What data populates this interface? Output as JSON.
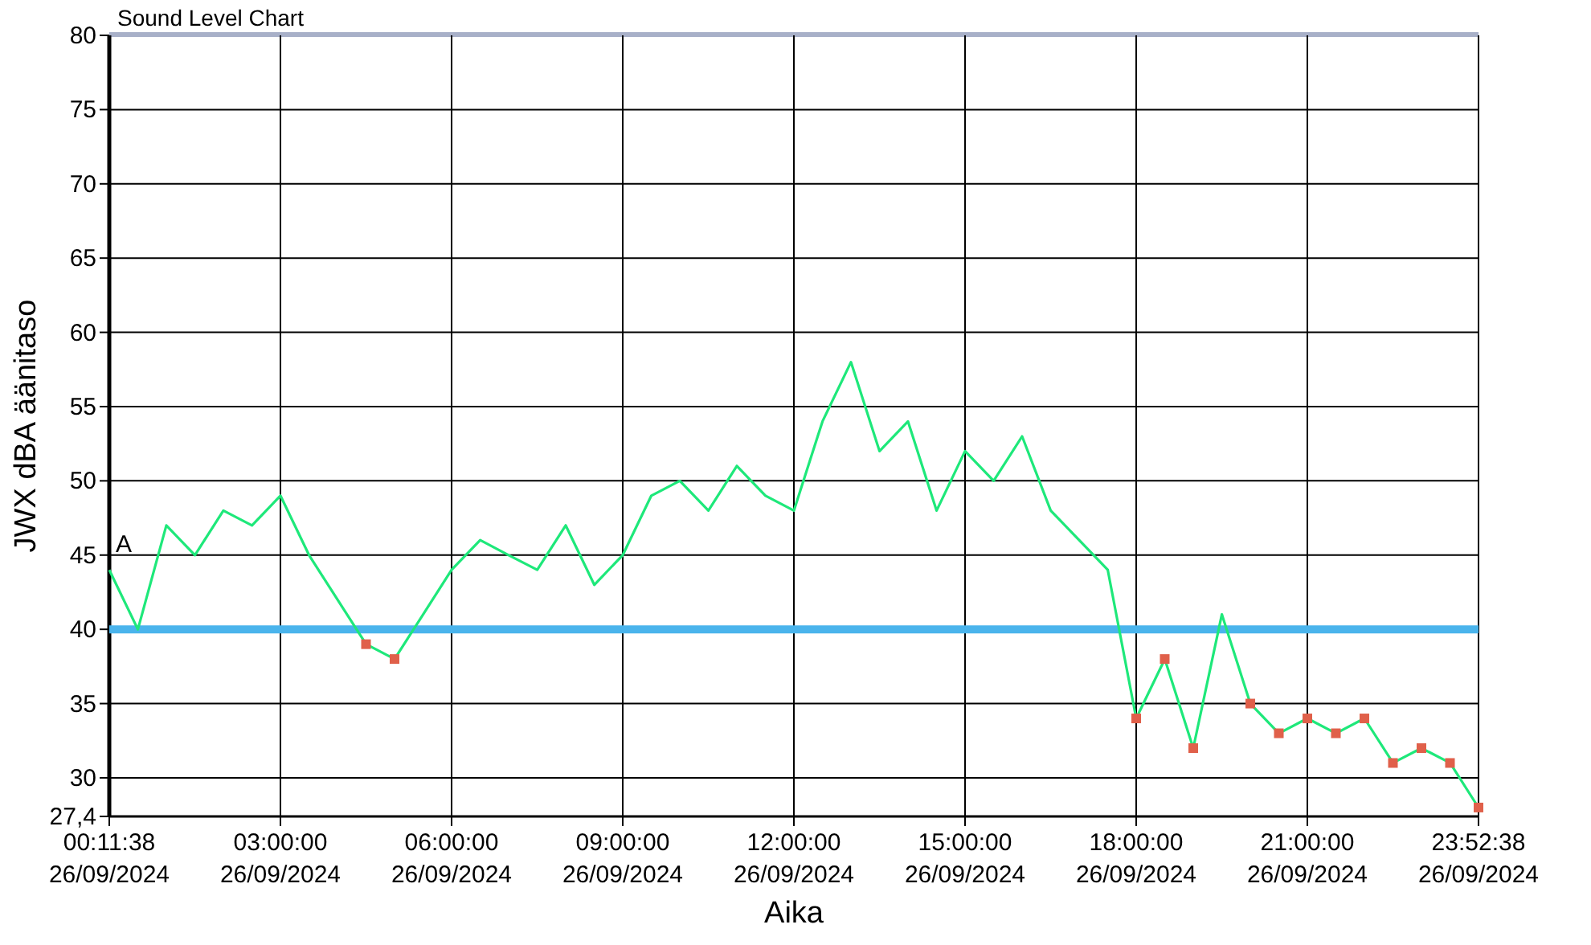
{
  "chart": {
    "chart_data": {
      "type": "line",
      "title": "Sound Level Chart",
      "xlabel": "Aika",
      "ylabel": "JWX dBA äänitaso",
      "categories": [
        "00:11:38\n26/09/2024",
        null,
        null,
        null,
        null,
        null,
        "03:00:00\n26/09/2024",
        null,
        null,
        null,
        null,
        null,
        "06:00:00\n26/09/2024",
        null,
        null,
        null,
        null,
        null,
        "09:00:00\n26/09/2024",
        null,
        null,
        null,
        null,
        null,
        "12:00:00\n26/09/2024",
        null,
        null,
        null,
        null,
        null,
        "15:00:00\n26/09/2024",
        null,
        null,
        null,
        null,
        null,
        "18:00:00\n26/09/2024",
        null,
        null,
        null,
        null,
        null,
        "21:00:00\n26/09/2024",
        null,
        null,
        null,
        null,
        null,
        "23:52:38\n26/09/2024"
      ],
      "series": [
        {
          "color": "#1ee87a",
          "values": [
            44,
            40,
            47,
            45,
            48,
            47,
            49,
            45,
            42,
            39,
            38,
            41,
            44,
            46,
            45,
            44,
            47,
            43,
            45,
            49,
            50,
            48,
            51,
            49,
            48,
            54,
            58,
            52,
            54,
            48,
            52,
            50,
            53,
            48,
            46,
            44,
            34,
            38,
            32,
            41,
            35,
            33,
            34,
            33,
            34,
            31,
            32,
            31,
            28
          ]
        },
        {
          "color": "#4ab4ec",
          "values": [
            40,
            40,
            40,
            40,
            40,
            40,
            40,
            40,
            40,
            40,
            40,
            40,
            40,
            40,
            40,
            40,
            40,
            40,
            40,
            40,
            40,
            40,
            40,
            40,
            40,
            40,
            40,
            40,
            40,
            40,
            40,
            40,
            40,
            40,
            40,
            40,
            40,
            40,
            40,
            40,
            40,
            40,
            40,
            40,
            40,
            40,
            40,
            40,
            40
          ]
        }
      ],
      "ylim": [
        27.4,
        80
      ],
      "yticks": [
        {
          "value": 27.4,
          "label": "27,4"
        },
        30,
        35,
        40,
        45,
        50,
        55,
        60,
        65,
        70,
        75,
        80
      ],
      "grid": true,
      "annotations": [
        "A"
      ]
    }
  }
}
